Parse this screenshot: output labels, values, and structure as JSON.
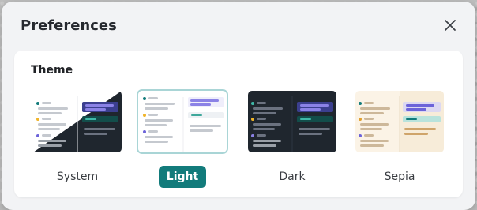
{
  "dialog": {
    "title": "Preferences",
    "close_icon": "close-icon"
  },
  "theme_section": {
    "label": "Theme",
    "selected": "Light",
    "options": [
      {
        "label": "System",
        "colors": {
          "bg": "#ffffff",
          "alt": "#1f262e",
          "accent": "#6c63d9"
        }
      },
      {
        "label": "Light",
        "colors": {
          "bg": "#ffffff",
          "sidebar": "#f3f4f6",
          "accent": "#8b82e6"
        }
      },
      {
        "label": "Dark",
        "colors": {
          "bg": "#1f262e",
          "sidebar": "#2a323c",
          "accent": "#6c63d9"
        }
      },
      {
        "label": "Sepia",
        "colors": {
          "bg": "#fbf3e6",
          "sidebar": "#f3e7d3",
          "accent": "#9fd6d0"
        }
      }
    ]
  },
  "colors": {
    "accent": "#127b7b",
    "selected_border": "#a9d5d6",
    "dialog_bg": "#f2f3f5"
  }
}
